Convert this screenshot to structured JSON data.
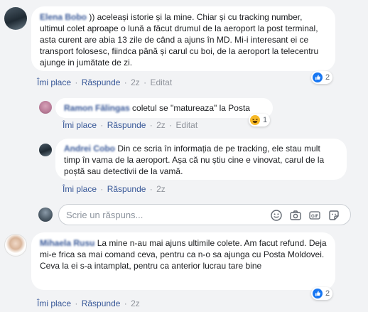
{
  "comments": [
    {
      "author": "Elena Bobo",
      "text": ")) aceleași istorie și la mine. Chiar și cu tracking number, ultimul colet aproape o lună a făcut drumul de la aeroport la post terminal, asta curent are abia 13 zile de când a ajuns în MD. Mi-i interesant ei ce transport folosesc, fiindca până și carul cu boi, de la aeroport la telecentru ajunge in jumătate de zi.",
      "like_label": "Îmi place",
      "reply_label": "Răspunde",
      "time": "2z",
      "edited": "Editat",
      "reaction_count": "2"
    },
    {
      "author": "Ramon Fălingas",
      "text": "coletul se \"matureaza\" la Posta",
      "like_label": "Îmi place",
      "reply_label": "Răspunde",
      "time": "2z",
      "edited": "Editat",
      "reaction_count": "1"
    },
    {
      "author": "Andrei Cobo",
      "text": "Din ce scria în informația de pe tracking, ele stau mult timp în vama de la aeroport. Așa că nu știu cine e vinovat, carul de la poștă sau detectivii de la vamă.",
      "like_label": "Îmi place",
      "reply_label": "Răspunde",
      "time": "2z"
    },
    {
      "author": "Mihaela Rusu",
      "text": "La mine n-au mai ajuns ultimile colete. Am facut refund. Deja mi-e frica sa mai comand ceva, pentru ca n-o sa ajunga cu Posta Moldovei. Ceva la ei s-a intamplat, pentru ca anterior lucrau tare bine",
      "like_label": "Îmi place",
      "reply_label": "Răspunde",
      "time": "2z",
      "reaction_count": "2"
    }
  ],
  "reply_box": {
    "placeholder": "Scrie un răspuns..."
  },
  "separator": "·",
  "colors": {
    "link": "#385898",
    "like_blue": "#1877f2",
    "haha_yellow": "#f7b928",
    "bubble_bg": "#ffffff",
    "page_bg": "#f2f3f5"
  },
  "icons": [
    "like-reaction-icon",
    "haha-reaction-icon",
    "emoji-icon",
    "camera-icon",
    "gif-icon",
    "sticker-icon"
  ]
}
